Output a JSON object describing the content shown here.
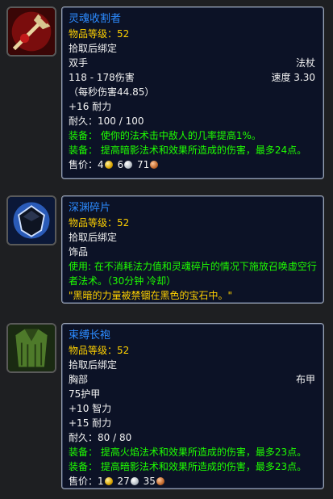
{
  "items": [
    {
      "name": "灵魂收割者",
      "ilvl_label": "物品等级：",
      "ilvl": "52",
      "bind": "拾取后绑定",
      "slot": "双手",
      "type": "法杖",
      "damage": "118 - 178伤害",
      "speed": "速度 3.30",
      "dps": "（每秒伤害44.85）",
      "stat1": "+16 耐力",
      "durability": "耐久：100 / 100",
      "equip1": "装备： 使你的法术击中敌人的几率提高1%。",
      "equip2": "装备： 提高暗影法术和效果所造成的伤害，最多24点。",
      "sell_label": "售价：",
      "gold": "4",
      "silver": "6",
      "copper": "71",
      "icon": "blood-staff-icon"
    },
    {
      "name": "深渊碎片",
      "ilvl_label": "物品等级：",
      "ilvl": "52",
      "bind": "拾取后绑定",
      "category": "饰品",
      "use": "使用: 在不消耗法力值和灵魂碎片的情况下施放召唤虚空行者法术。（30分钟 冷却）",
      "flavor": "\"黑暗的力量被禁锢在黑色的宝石中。\"",
      "icon": "black-gem-icon"
    },
    {
      "name": "束缚长袍",
      "ilvl_label": "物品等级：",
      "ilvl": "52",
      "bind": "拾取后绑定",
      "slot": "胸部",
      "type": "布甲",
      "armor": "75护甲",
      "stat1": "+10 智力",
      "stat2": "+15 耐力",
      "durability": "耐久：80 / 80",
      "equip1": "装备： 提高火焰法术和效果所造成的伤害，最多23点。",
      "equip2": "装备： 提高暗影法术和效果所造成的伤害，最多23点。",
      "sell_label": "售价：",
      "gold": "1",
      "silver": "27",
      "copper": "35",
      "icon": "green-robe-icon"
    }
  ]
}
